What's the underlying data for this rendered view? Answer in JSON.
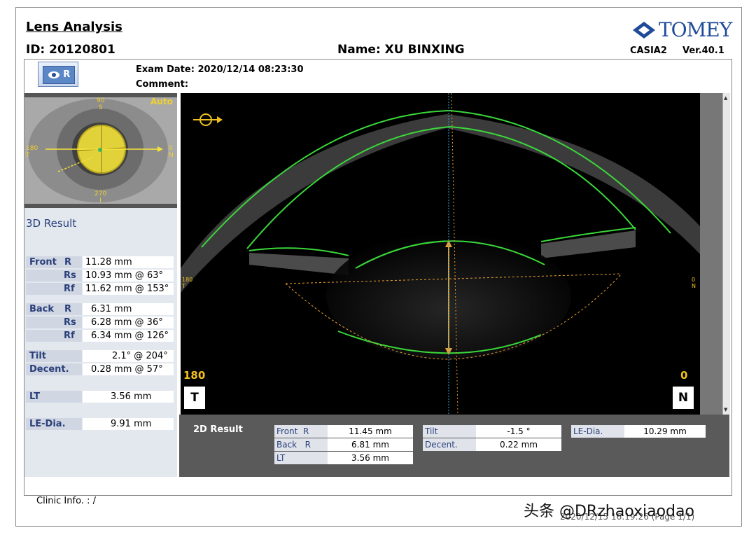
{
  "header": {
    "title": "Lens Analysis",
    "id_label": "ID:",
    "id_value": "20120801",
    "name_label": "Name:",
    "name_value": "XU BINXING",
    "brand": "TOMEY",
    "model": "CASIA2",
    "version": "Ver.40.1"
  },
  "exam": {
    "eye_label": "R",
    "exam_date_label": "Exam Date:",
    "exam_date": "2020/12/14 08:23:30",
    "comment_label": "Comment:"
  },
  "thumbnail": {
    "top_label": "90",
    "top_sub": "S",
    "bottom_label": "270",
    "bottom_sub": "I",
    "left_label": "180",
    "left_sub": "T",
    "right_label": "0",
    "right_sub": "N",
    "mode": "Auto"
  },
  "result3d": {
    "title": "3D Result",
    "front_label": "Front",
    "front": [
      {
        "k": "R",
        "v": "11.28 mm"
      },
      {
        "k": "Rs",
        "v": "10.93 mm @ 63°"
      },
      {
        "k": "Rf",
        "v": "11.62 mm @ 153°"
      }
    ],
    "back_label": "Back",
    "back": [
      {
        "k": "R",
        "v": "6.31 mm"
      },
      {
        "k": "Rs",
        "v": "6.28 mm @ 36°"
      },
      {
        "k": "Rf",
        "v": "6.34 mm @ 126°"
      }
    ],
    "tilt_label": "Tilt",
    "tilt": "2.1° @ 204°",
    "decent_label": "Decent.",
    "decent": "0.28 mm @ 57°",
    "lt_label": "LT",
    "lt": "3.56 mm",
    "lediaa_label": "LE-Dia.",
    "lediaa": "9.91 mm"
  },
  "scan": {
    "left_angle": "180",
    "left_side": "T",
    "right_angle": "0",
    "right_side": "N",
    "tiny_left": "180",
    "tiny_left_sub": "T",
    "tiny_right": "0",
    "tiny_right_sub": "N"
  },
  "result2d": {
    "title": "2D Result",
    "front_label": "Front",
    "front_k": "R",
    "front_v": "11.45 mm",
    "back_label": "Back",
    "back_k": "R",
    "back_v": "6.81 mm",
    "lt_label": "LT",
    "lt_v": "3.56 mm",
    "tilt_label": "Tilt",
    "tilt_v": "-1.5 °",
    "decent_label": "Decent.",
    "decent_v": "0.22 mm",
    "ledia_label": "LE-Dia.",
    "ledia_v": "10.29 mm"
  },
  "footer": {
    "clinic": "Clinic Info. :  /",
    "printed": "2020/12/15 16:19:26   (Page 1/1)",
    "watermark": "头条 @DRzhaoxiaodao"
  },
  "colors": {
    "brand_blue": "#1f4a9a",
    "contour_green": "#39d43a",
    "measure_orange": "#e8a030",
    "marker_yellow": "#f0c020"
  }
}
